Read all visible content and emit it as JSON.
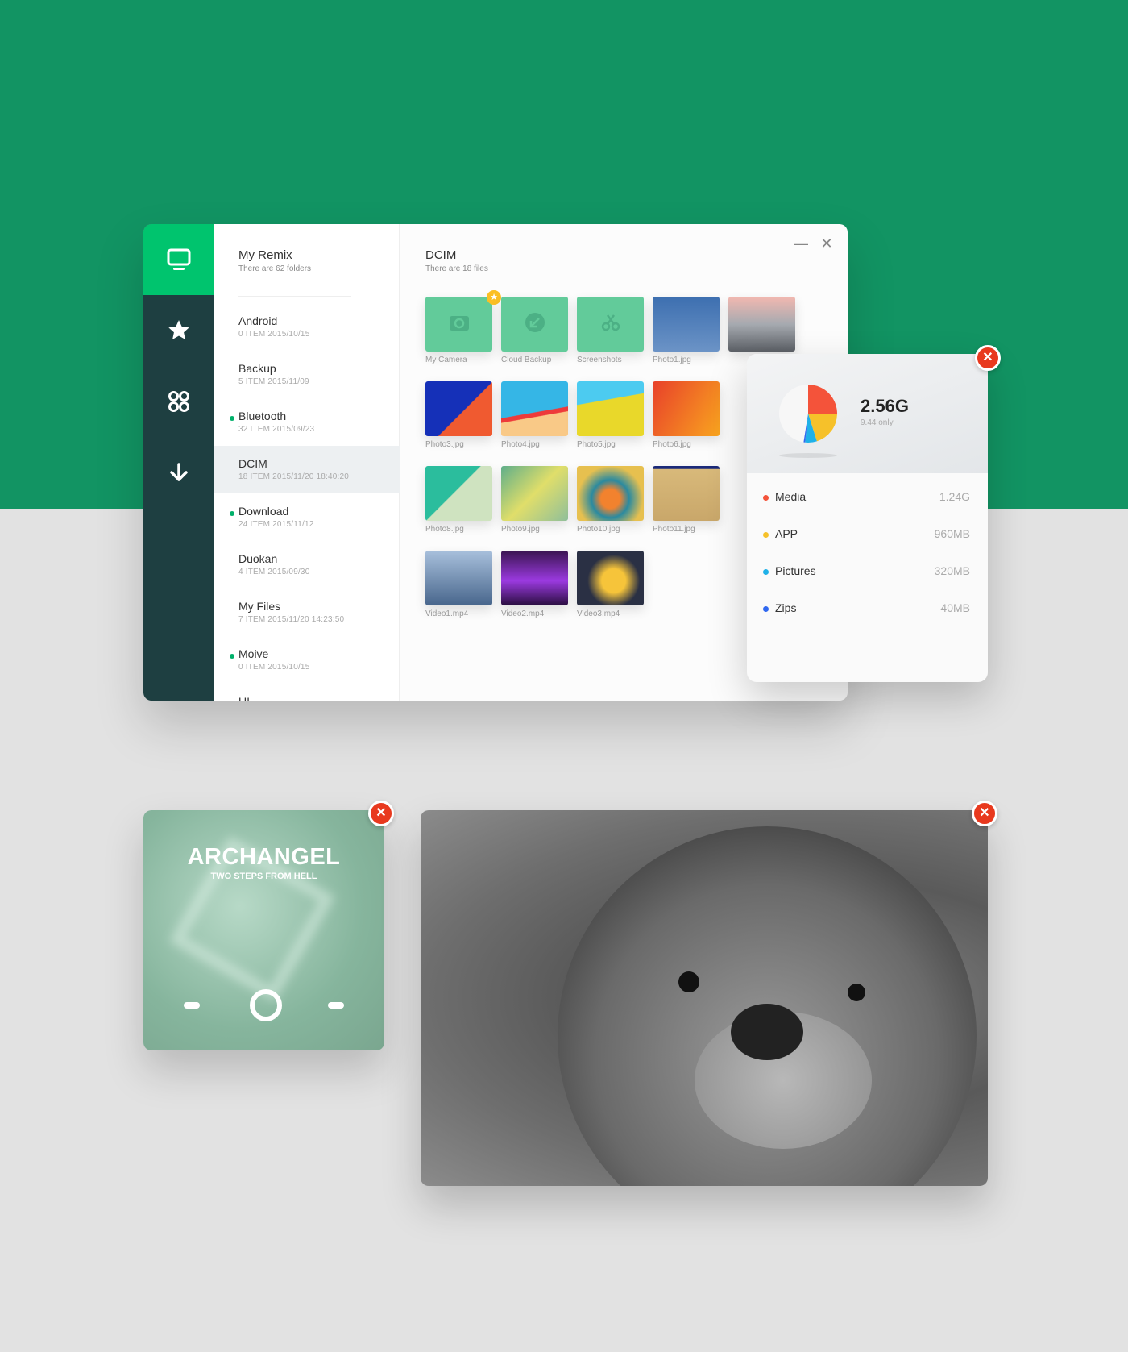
{
  "window": {
    "title": "My Remix",
    "subtitle": "There are 62 folders",
    "minimize_icon": "minimize-icon",
    "close_icon": "close-icon"
  },
  "sidebar": {
    "items": [
      {
        "icon": "monitor-icon",
        "active": true
      },
      {
        "icon": "star-icon"
      },
      {
        "icon": "apps-icon"
      },
      {
        "icon": "download-arrow-icon"
      }
    ]
  },
  "folders": [
    {
      "name": "Android",
      "meta": "0 ITEM  2015/10/15",
      "dot": false
    },
    {
      "name": "Backup",
      "meta": "5 ITEM  2015/11/09",
      "dot": false
    },
    {
      "name": "Bluetooth",
      "meta": "32 ITEM  2015/09/23",
      "dot": true
    },
    {
      "name": "DCIM",
      "meta": "18 ITEM  2015/11/20 18:40:20",
      "dot": false,
      "selected": true
    },
    {
      "name": "Download",
      "meta": "24 ITEM  2015/11/12",
      "dot": true
    },
    {
      "name": "Duokan",
      "meta": "4 ITEM  2015/09/30",
      "dot": false
    },
    {
      "name": "My Files",
      "meta": "7 ITEM  2015/11/20 14:23:50",
      "dot": false
    },
    {
      "name": "Moive",
      "meta": "0 ITEM  2015/10/15",
      "dot": true
    },
    {
      "name": "UI",
      "meta": "",
      "dot": false
    }
  ],
  "main": {
    "title": "DCIM",
    "subtitle": "There are 18 files",
    "files": [
      {
        "name": "My Camera",
        "kind": "folder",
        "icon": "camera-icon",
        "starred": true
      },
      {
        "name": "Cloud Backup",
        "kind": "folder",
        "icon": "cloud-sync-icon"
      },
      {
        "name": "Screenshots",
        "kind": "folder",
        "icon": "scissors-icon"
      },
      {
        "name": "Photo1.jpg",
        "kind": "image"
      },
      {
        "name": "",
        "kind": "image"
      },
      {
        "name": "Photo3.jpg",
        "kind": "image"
      },
      {
        "name": "Photo4.jpg",
        "kind": "image"
      },
      {
        "name": "Photo5.jpg",
        "kind": "image"
      },
      {
        "name": "Photo6.jpg",
        "kind": "image"
      },
      {
        "name": "Photo8.jpg",
        "kind": "image"
      },
      {
        "name": "Photo9.jpg",
        "kind": "image"
      },
      {
        "name": "Photo10.jpg",
        "kind": "image"
      },
      {
        "name": "Photo11.jpg",
        "kind": "image"
      },
      {
        "name": "Video1.mp4",
        "kind": "video"
      },
      {
        "name": "Video2.mp4",
        "kind": "video"
      },
      {
        "name": "Video3.mp4",
        "kind": "video"
      }
    ]
  },
  "storage": {
    "total": "2.56G",
    "note": "9.44 only",
    "items": [
      {
        "label": "Media",
        "value": "1.24G",
        "mb": 1240,
        "color": "#f4533a"
      },
      {
        "label": "APP",
        "value": "960MB",
        "mb": 960,
        "color": "#f6c12a"
      },
      {
        "label": "Pictures",
        "value": "320MB",
        "mb": 320,
        "color": "#1fb1e8"
      },
      {
        "label": "Zips",
        "value": "40MB",
        "mb": 40,
        "color": "#3068f0"
      }
    ]
  },
  "music": {
    "title": "ARCHANGEL",
    "artist": "TWO STEPS FROM HELL",
    "controls": [
      "previous",
      "play",
      "next"
    ]
  },
  "colors": {
    "brand_green": "#129463",
    "accent_green": "#00c46e",
    "sidebar": "#1e3f41",
    "close_red": "#e8391e"
  }
}
